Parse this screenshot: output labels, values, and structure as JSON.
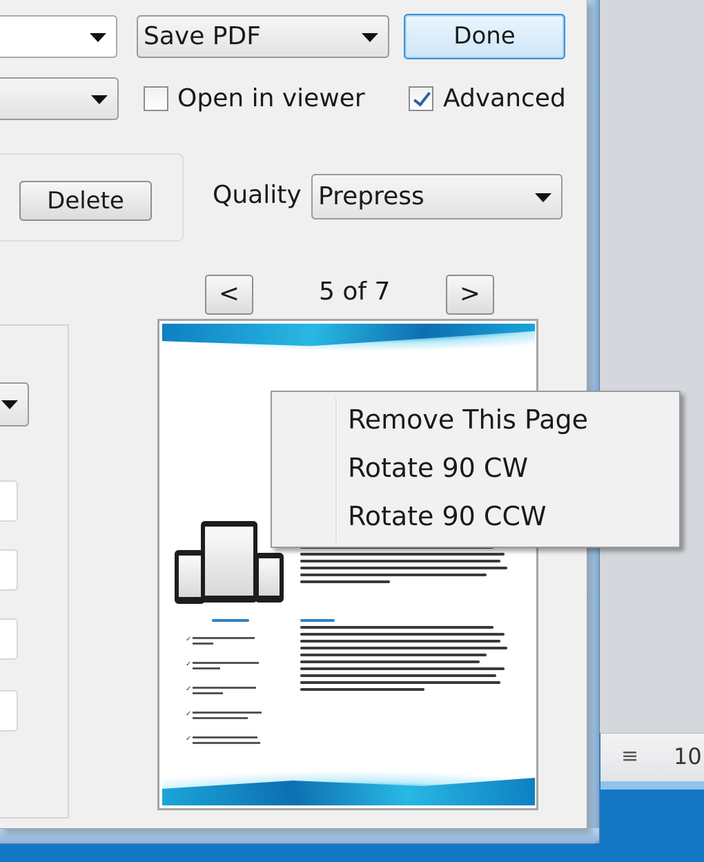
{
  "toolbar": {
    "action_select_value": "Save PDF",
    "done_label": "Done"
  },
  "options": {
    "open_in_viewer_label": "Open in viewer",
    "open_in_viewer_checked": false,
    "advanced_label": "Advanced",
    "advanced_checked": true
  },
  "preset": {
    "delete_label": "Delete"
  },
  "quality": {
    "label": "Quality",
    "value": "Prepress"
  },
  "preview": {
    "prev_label": "<",
    "next_label": ">",
    "page_indicator": "5 of 7"
  },
  "context_menu": {
    "items": [
      {
        "label": "Remove This Page"
      },
      {
        "label": "Rotate 90 CW"
      },
      {
        "label": "Rotate 90 CCW"
      }
    ]
  },
  "status_bar": {
    "zoom": "10"
  },
  "colors": {
    "taskbar": "#1477c4",
    "default_button_border": "#3c8fd6",
    "check_color": "#2c5fa8",
    "brochure_blue": "#0d7fc2"
  }
}
